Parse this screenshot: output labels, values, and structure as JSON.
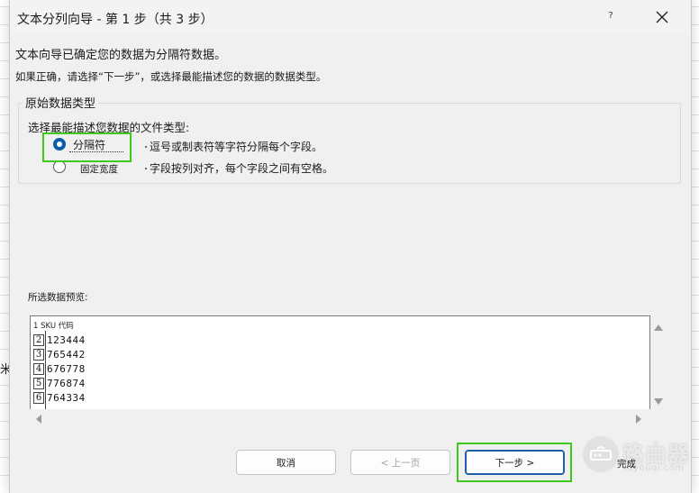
{
  "background": {
    "cell_text": "米"
  },
  "dialog": {
    "title": "文本分列向导 - 第 1 步（共 3 步）",
    "help_label": "?",
    "description": "文本向导已确定您的数据为分隔符数据。",
    "instruction": "如果正确，请选择“下一步”，或选择最能描述您的数据的数据类型。"
  },
  "data_type_group": {
    "legend": "原始数据类型",
    "prompt": "选择最能描述您数据的文件类型:",
    "options": [
      {
        "label": "分隔符",
        "description": "逗号或制表符等字符分隔每个字段。",
        "selected": true
      },
      {
        "label": "固定宽度",
        "description": "字段按列对齐，每个字段之间有空格。",
        "selected": false
      }
    ]
  },
  "preview": {
    "label": "所选数据预览:",
    "header": "1 SKU 代码",
    "rows": [
      {
        "num": "2",
        "value": "123444"
      },
      {
        "num": "3",
        "value": "765442"
      },
      {
        "num": "4",
        "value": "676778"
      },
      {
        "num": "5",
        "value": "776874"
      },
      {
        "num": "6",
        "value": "764334"
      }
    ]
  },
  "buttons": {
    "cancel": "取消",
    "back": "< 上一页",
    "next": "下一步 >",
    "finish": "完成"
  },
  "watermark": {
    "text": "路由器",
    "sub": "luyouqi.com"
  },
  "colors": {
    "highlight": "#3ec91b",
    "accent": "#0b5cad"
  }
}
